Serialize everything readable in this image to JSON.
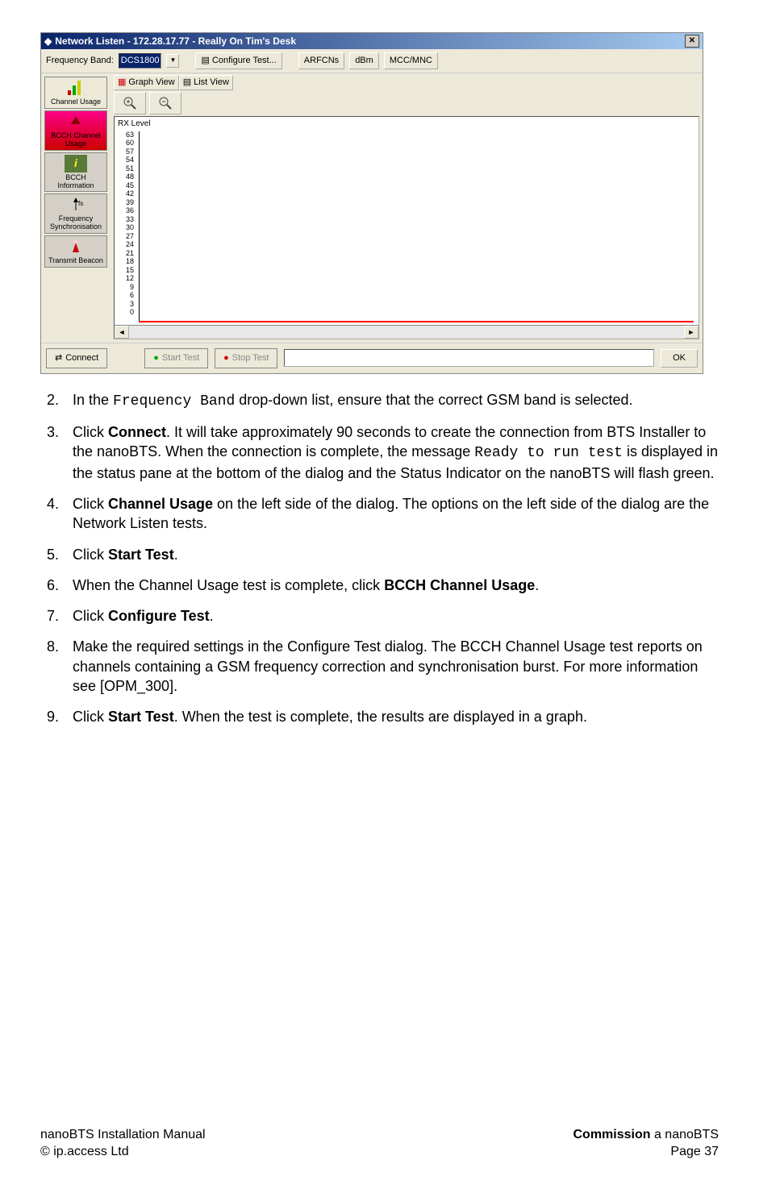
{
  "dialog": {
    "title": "Network Listen - 172.28.17.77 - Really On Tim's Desk",
    "toolbar": {
      "freq_band_label": "Frequency Band:",
      "freq_band_value": "DCS1800",
      "configure_test": "Configure Test...",
      "arfcns": "ARFCNs",
      "dbm": "dBm",
      "mcc_mnc": "MCC/MNC"
    },
    "sidebar": [
      {
        "label": "Channel Usage"
      },
      {
        "label": "BCCH Channel Usage"
      },
      {
        "label": "BCCH Information"
      },
      {
        "label": "Frequency Synchronisation"
      },
      {
        "label": "Transmit Beacon"
      }
    ],
    "view_tabs": {
      "graph": "Graph View",
      "list": "List View"
    },
    "chart": {
      "title": "RX Level"
    },
    "bottom": {
      "connect": "Connect",
      "start_test": "Start Test",
      "stop_test": "Stop Test",
      "ok": "OK"
    }
  },
  "chart_data": {
    "type": "bar",
    "title": "RX Level",
    "ylabel": "",
    "xlabel": "",
    "y_ticks": [
      63,
      60,
      57,
      54,
      51,
      48,
      45,
      42,
      39,
      36,
      33,
      30,
      27,
      24,
      21,
      18,
      15,
      12,
      9,
      6,
      3,
      0
    ],
    "ylim": [
      0,
      63
    ],
    "categories": [],
    "values": []
  },
  "instructions": [
    {
      "n": "2.",
      "html": "In the <span class='mono'>Frequency Band</span> drop-down list, ensure that the correct GSM band is selected."
    },
    {
      "n": "3.",
      "html": "Click <b>Connect</b>. It will take approximately 90 seconds to create the connection from BTS Installer to the nanoBTS. When the connection is complete, the message <span class='mono'>Ready to run test</span> is displayed in the status pane at the bottom of the dialog and the Status Indicator on the nanoBTS will flash green."
    },
    {
      "n": "4.",
      "html": "Click <b>Channel Usage</b> on the left side of the dialog. The options on the left side of the dialog are the Network Listen tests."
    },
    {
      "n": "5.",
      "html": "Click <b>Start Test</b>."
    },
    {
      "n": "6.",
      "html": "When the Channel Usage test is complete, click <b>BCCH Channel Usage</b>."
    },
    {
      "n": "7.",
      "html": "Click <b>Configure Test</b>."
    },
    {
      "n": "8.",
      "html": "Make the required settings in the Configure Test dialog. The BCCH Channel Usage test reports on channels containing a GSM frequency correction and synchronisation burst. For more information see [OPM_300]."
    },
    {
      "n": "9.",
      "html": "Click <b>Start Test</b>. When the test is complete, the results are displayed in a graph."
    }
  ],
  "footer": {
    "left_top": "nanoBTS Installation Manual",
    "left_bottom": "© ip.access Ltd",
    "right_top_pre": "Commission",
    "right_top_post": " a nanoBTS",
    "right_bottom": "Page 37"
  }
}
